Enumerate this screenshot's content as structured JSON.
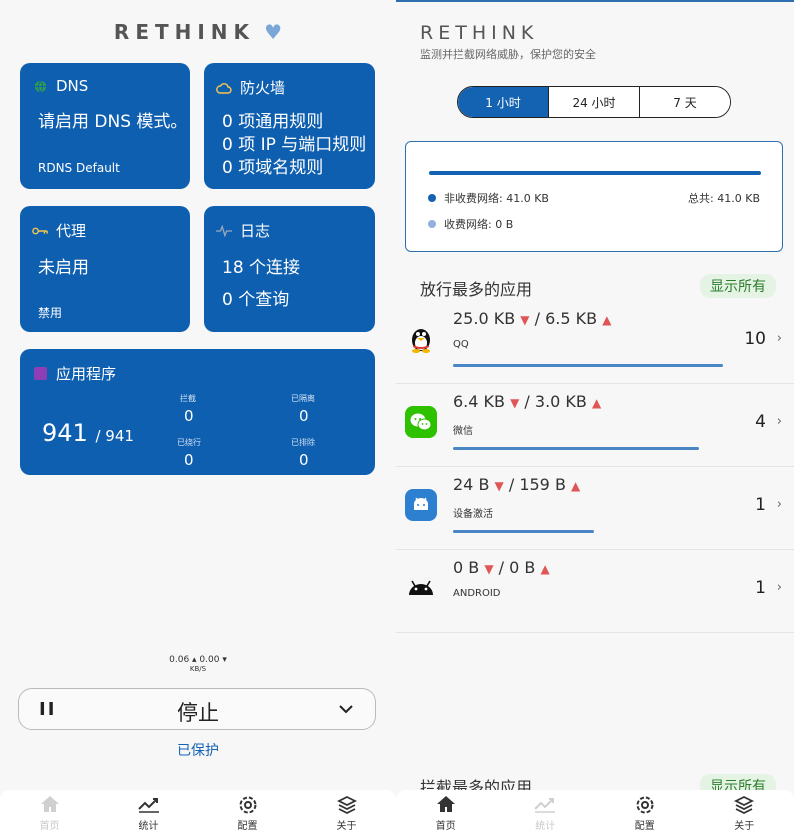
{
  "left": {
    "brand": "RETHINK",
    "cards": {
      "dns": {
        "title": "DNS",
        "main": "请启用 DNS 模式。",
        "sub": "RDNS Default"
      },
      "firewall": {
        "title": "防火墙",
        "line1": "0 项通用规则",
        "line2": "0 项 IP 与端口规则",
        "line3": "0 项域名规则"
      },
      "proxy": {
        "title": "代理",
        "main": "未启用",
        "sub": "禁用"
      },
      "logs": {
        "title": "日志",
        "line1": "18 个连接",
        "line2": "0 个查询"
      },
      "apps": {
        "title": "应用程序",
        "count": "941",
        "total": "/ 941",
        "blocked_label": "拦截",
        "blocked": "0",
        "isolated_label": "已隔离",
        "isolated": "0",
        "bypassed_label": "已绕行",
        "bypassed": "0",
        "excluded_label": "已排除",
        "excluded": "0"
      }
    },
    "speed": {
      "value": "0.06 ▴ 0.00 ▾",
      "unit": "KB/S"
    },
    "stop_button": {
      "pause": "II",
      "label": "停止",
      "chevron": "⌄"
    },
    "status": "已保护"
  },
  "right": {
    "brand": "RETHINK",
    "subtitle": "监测并拦截网络威胁，保护您的安全",
    "segments": [
      "1 小时",
      "24 小时",
      "7 天"
    ],
    "usage": {
      "unmetered": "非收费网络: 41.0 KB",
      "metered": "收费网络: 0 B",
      "total": "总共: 41.0 KB",
      "unmetered_fraction": 1.0,
      "colors": {
        "unmetered": "#1463b3",
        "metered": "#8fb3dc"
      }
    },
    "top_allowed_title": "放行最多的应用",
    "top_blocked_title": "拦截最多的应用",
    "show_all": "显示所有",
    "apps": [
      {
        "down": "25.0 KB",
        "up": "/ 6.5 KB",
        "name": "QQ",
        "count": "10",
        "icon": "penguin-icon",
        "bar_fraction": 0.9
      },
      {
        "down": "6.4 KB",
        "up": "/ 3.0 KB",
        "name": "微信",
        "count": "4",
        "icon": "wechat-icon",
        "bar_fraction": 0.82
      },
      {
        "down": "24 B",
        "up": "/ 159 B",
        "name": "设备激活",
        "count": "1",
        "icon": "android-app-icon",
        "bar_fraction": 0.47
      },
      {
        "down": "0 B",
        "up": "/ 0 B",
        "name": "ANDROID",
        "count": "1",
        "icon": "android-icon",
        "bar_fraction": 0
      }
    ]
  },
  "nav": [
    {
      "label": "首页",
      "icon": "home-icon"
    },
    {
      "label": "统计",
      "icon": "chart-icon"
    },
    {
      "label": "配置",
      "icon": "gear-icon"
    },
    {
      "label": "关于",
      "icon": "layers-icon"
    }
  ],
  "colors": {
    "card": "#0f5fb0",
    "accent": "#1463b3",
    "show_all_bg": "#e4f3e4",
    "arrow": "#e05555"
  }
}
